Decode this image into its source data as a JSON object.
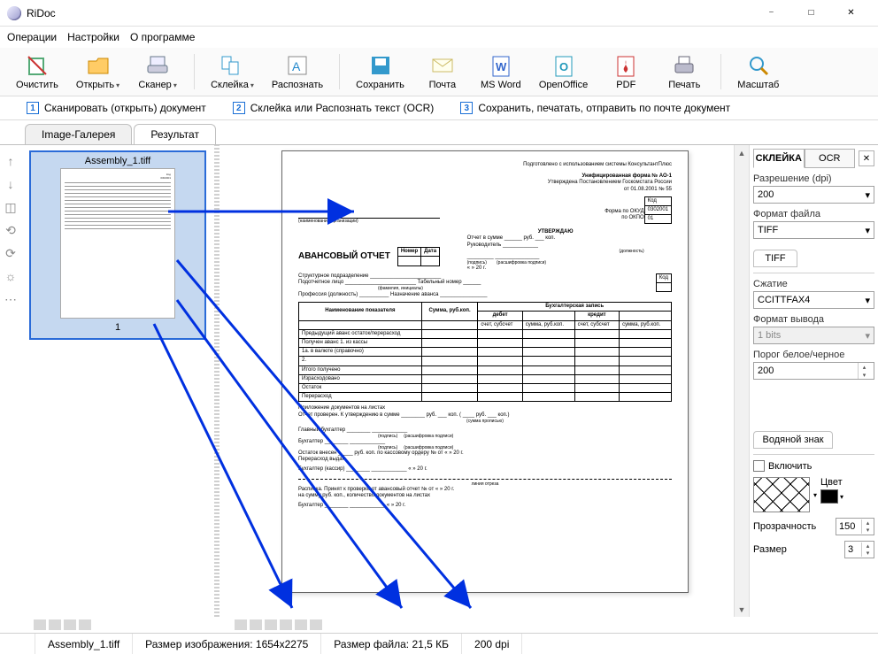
{
  "window": {
    "title": "RiDoc"
  },
  "menu": {
    "ops": "Операции",
    "settings": "Настройки",
    "about": "О программе"
  },
  "toolbar": {
    "clear": "Очистить",
    "open": "Открыть",
    "scanner": "Сканер",
    "glue": "Склейка",
    "recognize": "Распознать",
    "save": "Сохранить",
    "mail": "Почта",
    "msword": "MS Word",
    "openoffice": "OpenOffice",
    "pdf": "PDF",
    "print": "Печать",
    "zoom": "Масштаб"
  },
  "steps": {
    "s1": "Сканировать (открыть) документ",
    "s2": "Склейка или Распознать текст (OCR)",
    "s3": "Сохранить, печатать, отправить по почте документ"
  },
  "tabs": {
    "gallery": "Image-Галерея",
    "result": "Результат"
  },
  "thumb": {
    "file": "Assembly_1.tiff",
    "index": "1"
  },
  "right": {
    "tab_glue": "СКЛЕЙКА",
    "tab_ocr": "OCR",
    "dpi_label": "Разрешение (dpi)",
    "dpi": "200",
    "fmt_label": "Формат файла",
    "fmt": "TIFF",
    "tiff_tab": "TIFF",
    "comp_label": "Сжатие",
    "comp": "CCITTFAX4",
    "out_label": "Формат вывода",
    "out": "1 bits",
    "thresh_label": "Порог белое/черное",
    "thresh": "200",
    "wm_tab": "Водяной знак",
    "wm_enable": "Включить",
    "wm_color": "Цвет",
    "wm_opacity_label": "Прозрачность",
    "wm_opacity": "150",
    "wm_size_label": "Размер",
    "wm_size": "3"
  },
  "status": {
    "file": "Assembly_1.tiff",
    "imgsize": "Размер изображения: 1654x2275",
    "filesize": "Размер файла: 21,5 КБ",
    "dpi": "200 dpi"
  },
  "doc": {
    "topnote": "Подготовлено с использованием системы КонсультантПлюс",
    "form": "Унифицированная форма № АО-1",
    "approved": "Утверждена Постановлением Госкомстата России",
    "date": "от 01.08.2001 № 55",
    "code": "Код",
    "okud": "0302001",
    "okpo": "01",
    "okud_l": "Форма по ОКУД",
    "okpo_l": "по ОКПО",
    "org": "(наименование организации)",
    "approve": "УТВЕРЖДАЮ",
    "reportsum": "Отчет в сумме",
    "rub": "руб.",
    "kop": "коп.",
    "head": "Руководитель",
    "pos": "(должность)",
    "sign": "(подпись)",
    "fio": "(расшифровка подписи)",
    "title": "АВАНСОВЫЙ ОТЧЕТ",
    "numdate_n": "Номер",
    "numdate_d": "Дата",
    "g": "« »           20    г.",
    "sub": "Структурное подразделение",
    "person": "Подотчетное лицо",
    "tabnum": "Табельный номер",
    "prof": "Профессия (должность)",
    "purpose": "Назначение аванса",
    "col_name": "Наименование показателя",
    "col_sum": "Сумма, руб.коп.",
    "col_acc": "Бухгалтерская запись",
    "col_debit": "дебет",
    "col_credit": "кредит",
    "col_acct": "счет, субсчет",
    "col_amt": "сумма, руб.коп.",
    "row_prev": "Предыдущий аванс",
    "row_ost": "остаток",
    "row_over": "перерасход",
    "row_got": "Получен аванс 1. из кассы",
    "row_cur": "1а. в валюте (справочно)",
    "row_2": "2.",
    "row_tot": "Итого получено",
    "row_spent": "Израсходовано",
    "row_ost2": "Остаток",
    "row_over2": "Перерасход",
    "att": "Приложение            документов на           листах",
    "rep": "Отчет проверен. К утверждению в сумме",
    "sumwords": "(сумма прописью)",
    "mainacc": "Главный бухгалтер",
    "acc": "Бухгалтер",
    "dep": "Остаток внесен",
    "depsum": "руб.           коп. по кассовому ордеру №           от «    »           20    г.",
    "dep2": "Перерасход выдан",
    "cash": "Бухгалтер (кассир)",
    "cut": "линия отреза",
    "rec": "Расписка. Принят к проверке от                        авансовый отчет №           от «    »           20    г.",
    "on": "на сумму                    руб.           коп., количество документов           на           листах"
  }
}
